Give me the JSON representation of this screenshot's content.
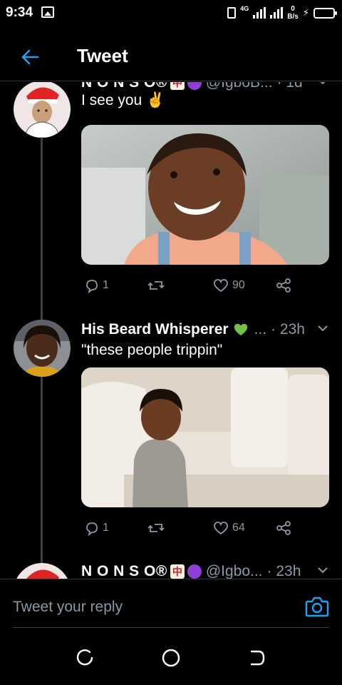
{
  "status_bar": {
    "time": "9:34",
    "network": "4G",
    "speed_value": "0",
    "speed_unit": "B/s"
  },
  "header": {
    "title": "Tweet"
  },
  "tweets": [
    {
      "name": "N O N S O®",
      "handle": "@IgboB...",
      "time": "· 1d",
      "text": "I see you ✌️",
      "replies": "1",
      "likes": "90"
    },
    {
      "name": "His Beard Whisperer",
      "handle": "...",
      "time": "· 23h",
      "text": "\"these people trippin\"",
      "replies": "1",
      "likes": "64"
    },
    {
      "name": "N O N S O®",
      "handle": "@Igbo...",
      "time": "· 23h"
    }
  ],
  "reply": {
    "placeholder": "Tweet your reply"
  },
  "icons": {
    "back": "arrow-left-icon",
    "reply": "speech-bubble-icon",
    "retweet": "retweet-icon",
    "like": "heart-icon",
    "share": "share-icon",
    "camera": "camera-icon"
  },
  "colors": {
    "accent": "#1da1f2",
    "muted": "#8b98a5",
    "background": "#000000"
  }
}
